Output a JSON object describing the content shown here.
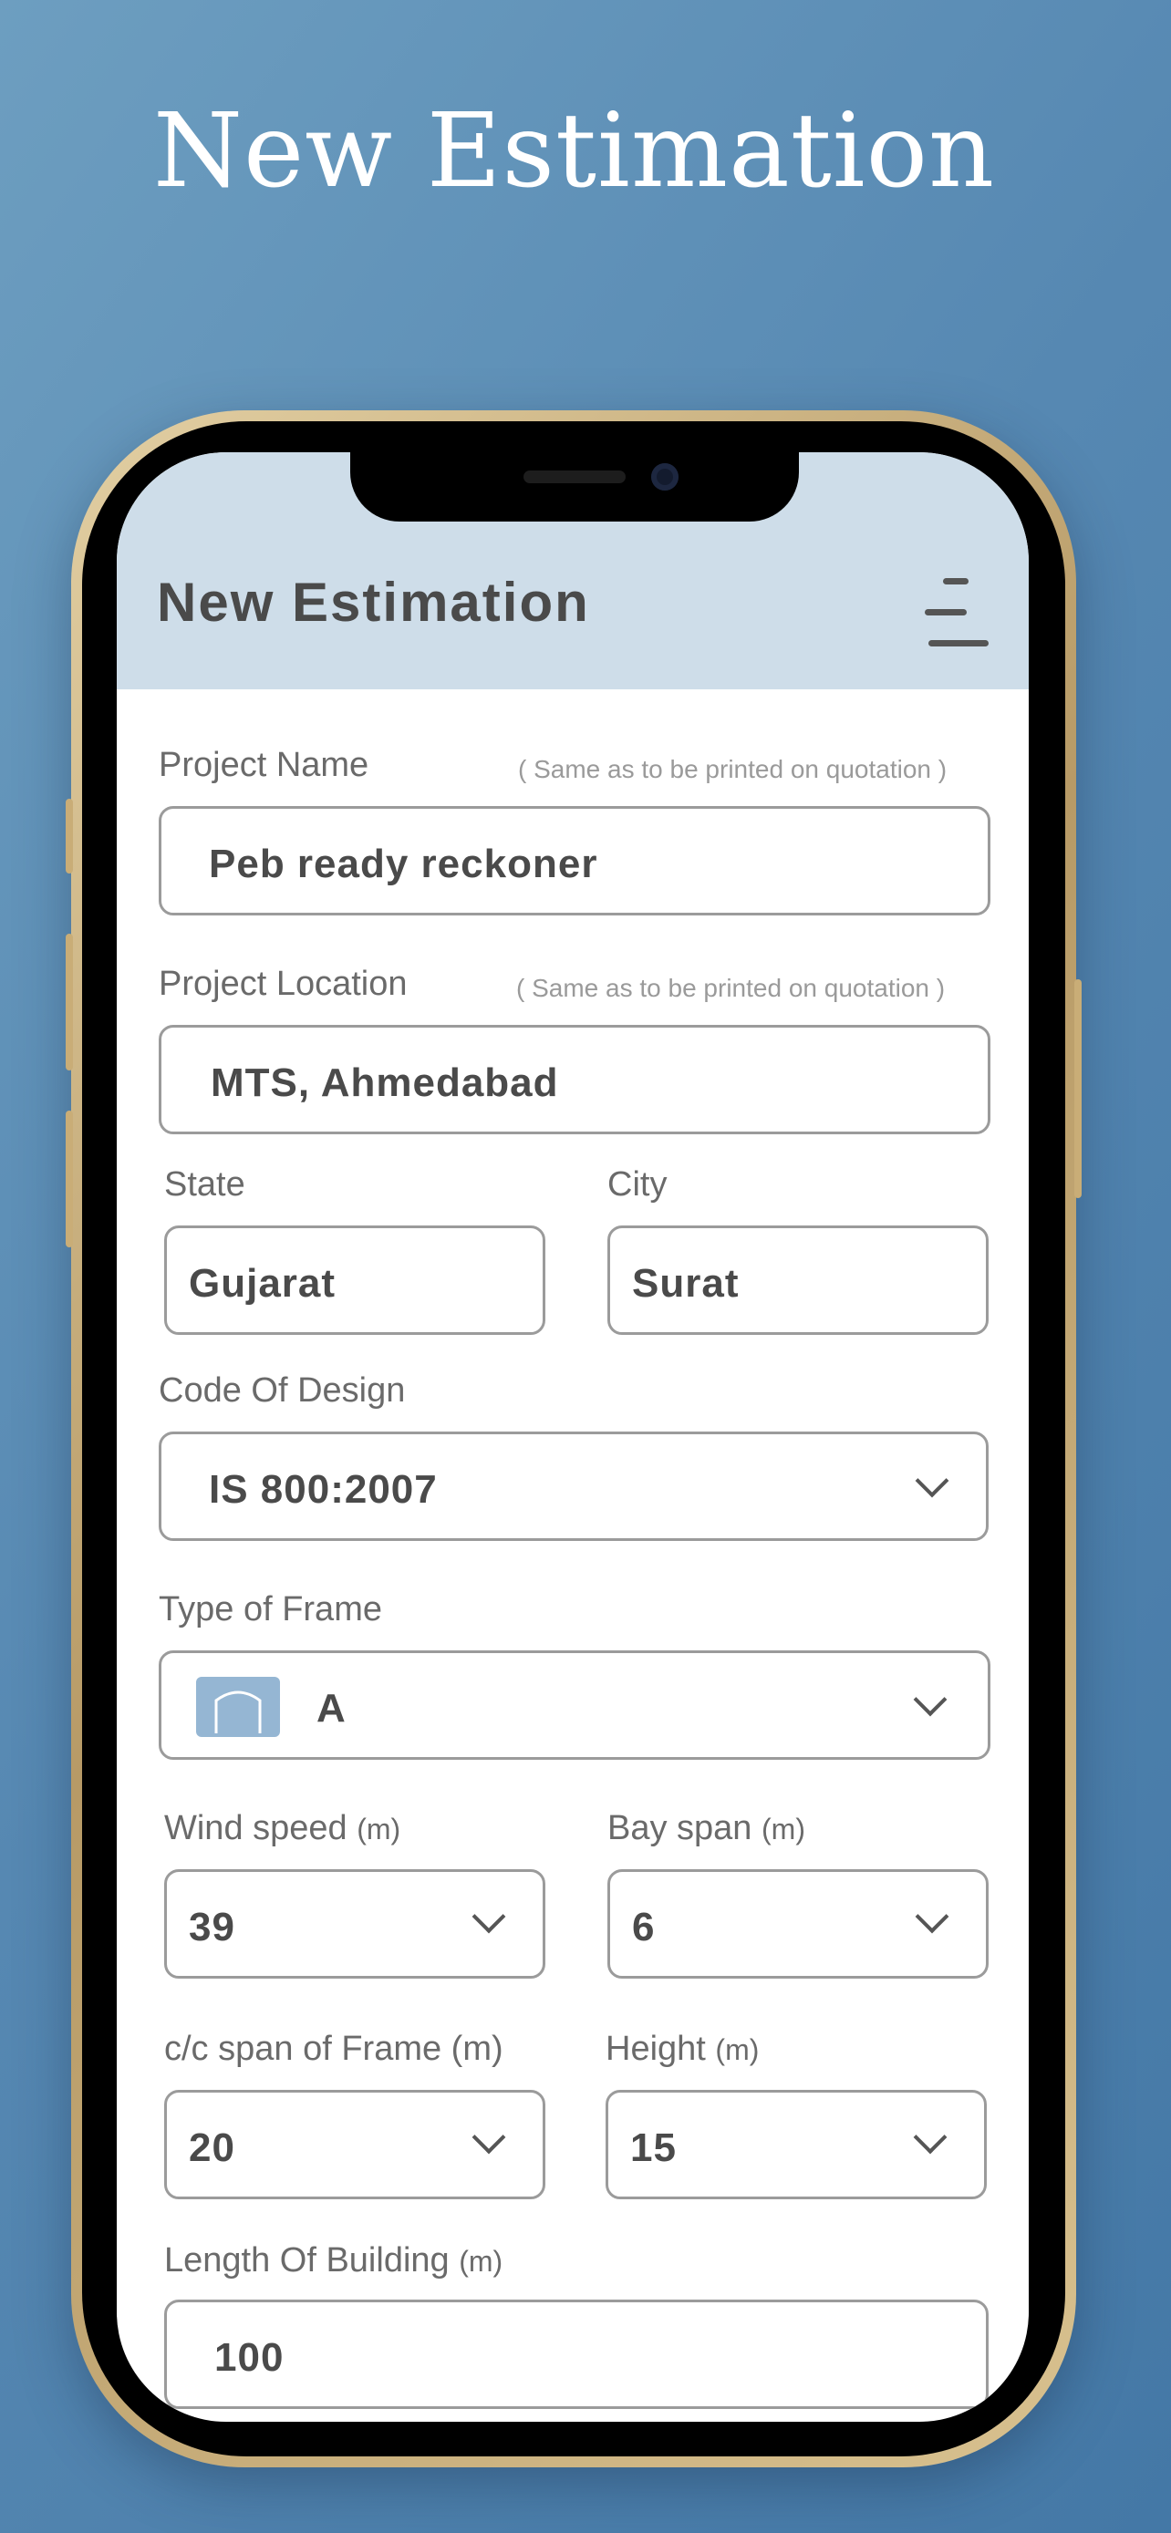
{
  "banner": {
    "title": "New Estimation"
  },
  "header": {
    "title": "New Estimation",
    "menu_icon": "hamburger-menu-icon"
  },
  "form": {
    "project_name": {
      "label": "Project Name",
      "hint": "( Same as to be printed on quotation )",
      "value": "Peb ready reckoner"
    },
    "project_location": {
      "label": "Project Location",
      "hint": "( Same as to be printed on quotation )",
      "value": "MTS, Ahmedabad"
    },
    "state": {
      "label": "State",
      "value": "Gujarat"
    },
    "city": {
      "label": "City",
      "value": "Surat"
    },
    "code_of_design": {
      "label": "Code Of Design",
      "value": "IS 800:2007"
    },
    "type_of_frame": {
      "label": "Type of Frame",
      "value": "A",
      "icon": "frame-shape-icon"
    },
    "wind_speed": {
      "label": "Wind speed",
      "unit": "(m)",
      "value": "39"
    },
    "bay_span": {
      "label": "Bay span",
      "unit": "(m)",
      "value": "6"
    },
    "cc_span": {
      "label": "c/c span of Frame (m)",
      "value": "20"
    },
    "height": {
      "label": "Height",
      "unit": "(m)",
      "value": "15"
    },
    "length_of_building": {
      "label": "Length Of Building",
      "unit": "(m)",
      "value": "100"
    }
  },
  "colors": {
    "header_bg": "#cedde9",
    "frame_icon_bg": "#95b6d3",
    "page_bg": "#5688b2"
  }
}
